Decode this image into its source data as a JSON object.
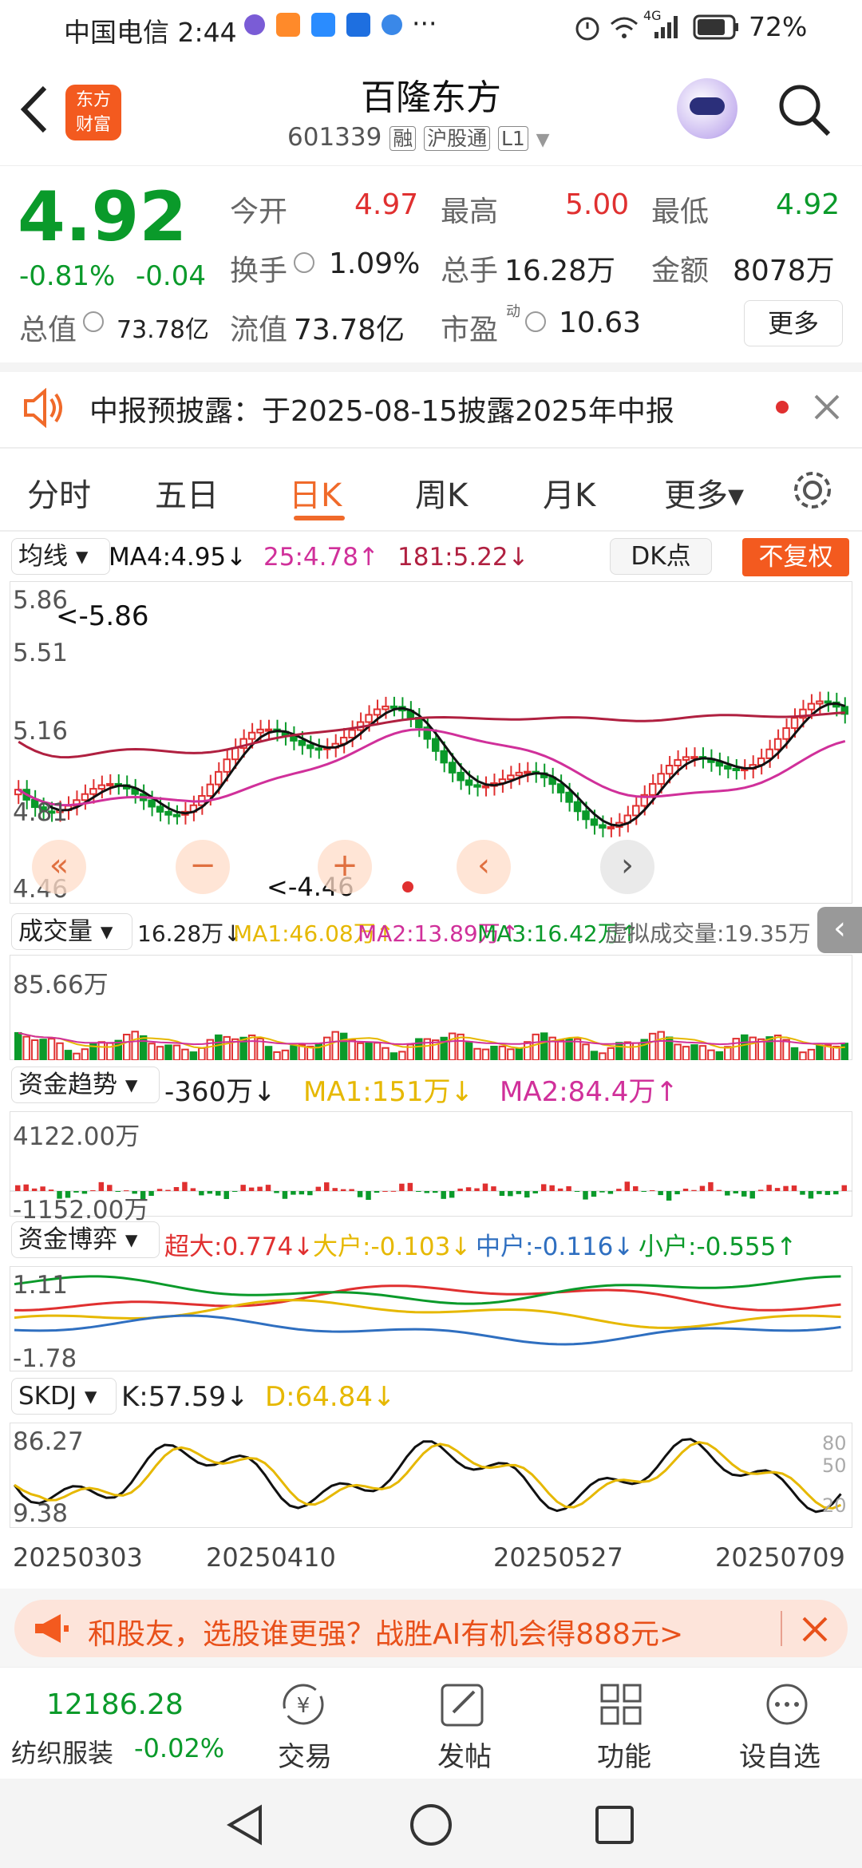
{
  "status": {
    "carrier_time": "中国电信 2:44",
    "more": "···",
    "signal": "4G",
    "battery": "72%"
  },
  "header": {
    "title": "百隆东方",
    "code": "601339",
    "badge_rong": "融",
    "badge_hgt": "沪股通",
    "badge_l1": "L1",
    "logo_top": "东方",
    "logo_bottom": "财富"
  },
  "quote": {
    "price": "4.92",
    "change_pct": "-0.81%",
    "change": "-0.04",
    "open_label": "今开",
    "open": "4.97",
    "high_label": "最高",
    "high": "5.00",
    "low_label": "最低",
    "low": "4.92",
    "turnover_label": "换手",
    "turnover": "1.09%",
    "volume_label": "总手",
    "volume": "16.28万",
    "amount_label": "金额",
    "amount": "8078万",
    "mktcap_label": "总值",
    "mktcap": "73.78亿",
    "float_label": "流值",
    "float": "73.78亿",
    "pe_label": "市盈",
    "pe_sup": "动",
    "pe": "10.63",
    "more_button": "更多"
  },
  "notice": {
    "text": "中报预披露：于2025-08-15披露2025年中报"
  },
  "tabs": {
    "t1": "分时",
    "t2": "五日",
    "t3": "日K",
    "t4": "周K",
    "t5": "月K",
    "t6": "更多▾"
  },
  "kline": {
    "ma_selector": "均线",
    "ma4": "MA4:4.95↓",
    "ma25": "25:4.78↑",
    "ma181": "181:5.22↓",
    "dk_button": "DK点",
    "fq_button": "不复权",
    "y_ticks": [
      "5.86",
      "5.51",
      "5.16",
      "4.81",
      "4.46"
    ],
    "max_label": "<-5.86",
    "min_label": "<-4.46",
    "colors": {
      "up": "#e03030",
      "down": "#0a9a2a",
      "ma4": "#111111",
      "ma25": "#d0309a",
      "ma181": "#b02040"
    }
  },
  "volume": {
    "selector": "成交量",
    "value": "16.28万↓",
    "ma1": "MA1:46.08万↑",
    "ma2": "MA2:13.89万↑",
    "ma3": "MA3:16.42万↑",
    "virtual": "虚拟成交量:19.35万",
    "max": "85.66万"
  },
  "fund": {
    "selector": "资金趋势",
    "value": "-360万↓",
    "ma1": "MA1:151万↓",
    "ma2": "MA2:84.4万↑",
    "top": "4122.00万",
    "bottom": "-1152.00万"
  },
  "game": {
    "selector": "资金博弈",
    "super": "超大:0.774↓",
    "big": "大户:-0.103↓",
    "mid": "中户:-0.116↓",
    "small": "小户:-0.555↑",
    "top": "1.11",
    "bottom": "-1.78"
  },
  "skdj": {
    "selector": "SKDJ",
    "k": "K:57.59↓",
    "d": "D:64.84↓",
    "top": "86.27",
    "bottom": "9.38",
    "r80": "80",
    "r50": "50",
    "r20": "20"
  },
  "dates": [
    "20250303",
    "20250410",
    "20250527",
    "20250709"
  ],
  "ad": {
    "text": "和股友，选股谁更强？战胜AI有机会得888元>"
  },
  "bottom_nav": {
    "index_value": "12186.28",
    "index_name": "纺织服装",
    "index_change": "-0.02%",
    "trade": "交易",
    "post": "发帖",
    "func": "功能",
    "watch": "设自选"
  }
}
